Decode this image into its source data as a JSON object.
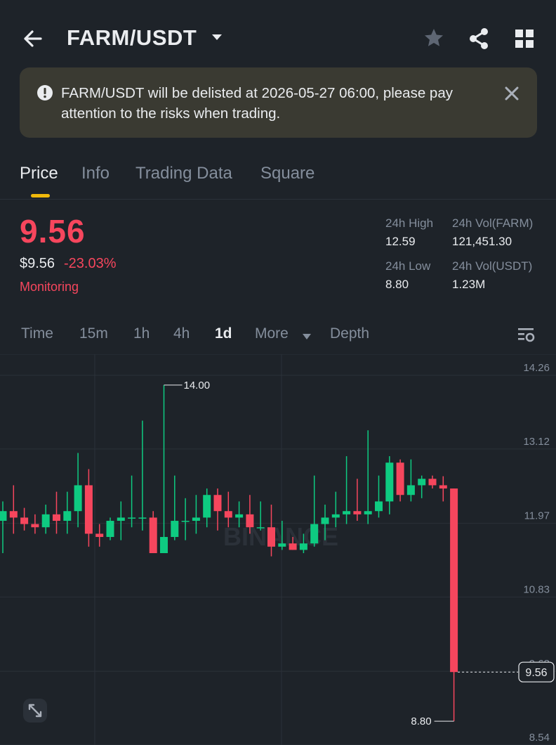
{
  "header": {
    "pair": "FARM/USDT",
    "icons": [
      "back-arrow-icon",
      "chevron-down-icon",
      "star-icon",
      "share-icon",
      "grid-icon"
    ]
  },
  "banner": {
    "text": "FARM/USDT will be delisted at 2026-05-27 06:00, please pay attention to the risks when trading.",
    "icon": "exclamation-circle-icon",
    "close_icon": "close-icon"
  },
  "tabs": [
    {
      "label": "Price",
      "active": true
    },
    {
      "label": "Info",
      "active": false
    },
    {
      "label": "Trading Data",
      "active": false
    },
    {
      "label": "Square",
      "active": false
    }
  ],
  "ticker": {
    "last_price": "9.56",
    "usd_price": "$9.56",
    "change": "-23.03%",
    "status": "Monitoring",
    "high_label": "24h High",
    "high_value": "12.59",
    "low_label": "24h Low",
    "low_value": "8.80",
    "vol_base_label": "24h Vol(FARM)",
    "vol_base_value": "121,451.30",
    "vol_quote_label": "24h Vol(USDT)",
    "vol_quote_value": "1.23M"
  },
  "timeframes": [
    {
      "label": "Time",
      "active": false
    },
    {
      "label": "15m",
      "active": false
    },
    {
      "label": "1h",
      "active": false
    },
    {
      "label": "4h",
      "active": false
    },
    {
      "label": "1d",
      "active": true
    },
    {
      "label": "More",
      "active": false
    },
    {
      "label": "Depth",
      "active": false
    }
  ],
  "colors": {
    "up": "#0ecb81",
    "down": "#f6465d",
    "accent": "#f0b90b",
    "bg": "#1e2329"
  },
  "chart_data": {
    "type": "candlestick",
    "y_ticks": [
      "14.26",
      "13.12",
      "11.97",
      "10.83",
      "9.68",
      "8.54"
    ],
    "ylim": [
      8.54,
      14.26
    ],
    "max_label": "14.00",
    "min_label": "8.80",
    "last_price_label": "9.56",
    "watermark": "BINANCE",
    "candles": [
      {
        "o": 11.9,
        "h": 12.2,
        "l": 11.4,
        "c": 12.05
      },
      {
        "o": 12.05,
        "h": 12.45,
        "l": 11.7,
        "c": 11.95
      },
      {
        "o": 11.95,
        "h": 12.1,
        "l": 11.75,
        "c": 11.85
      },
      {
        "o": 11.85,
        "h": 12.0,
        "l": 11.7,
        "c": 11.8
      },
      {
        "o": 11.8,
        "h": 12.15,
        "l": 11.7,
        "c": 12.0
      },
      {
        "o": 12.0,
        "h": 12.35,
        "l": 11.7,
        "c": 11.9
      },
      {
        "o": 11.9,
        "h": 12.35,
        "l": 11.7,
        "c": 12.05
      },
      {
        "o": 12.05,
        "h": 12.95,
        "l": 11.8,
        "c": 12.45
      },
      {
        "o": 12.45,
        "h": 12.7,
        "l": 11.5,
        "c": 11.7
      },
      {
        "o": 11.7,
        "h": 11.85,
        "l": 11.5,
        "c": 11.65
      },
      {
        "o": 11.65,
        "h": 11.95,
        "l": 11.6,
        "c": 11.9
      },
      {
        "o": 11.9,
        "h": 12.2,
        "l": 11.6,
        "c": 11.95
      },
      {
        "o": 11.95,
        "h": 12.6,
        "l": 11.8,
        "c": 11.95
      },
      {
        "o": 11.95,
        "h": 13.45,
        "l": 11.75,
        "c": 11.95
      },
      {
        "o": 11.95,
        "h": 12.05,
        "l": 11.4,
        "c": 11.4
      },
      {
        "o": 11.4,
        "h": 14.0,
        "l": 11.4,
        "c": 11.65
      },
      {
        "o": 11.65,
        "h": 12.6,
        "l": 11.6,
        "c": 11.9
      },
      {
        "o": 11.9,
        "h": 12.25,
        "l": 11.6,
        "c": 11.9
      },
      {
        "o": 11.9,
        "h": 12.3,
        "l": 11.7,
        "c": 11.95
      },
      {
        "o": 11.95,
        "h": 12.4,
        "l": 11.8,
        "c": 12.3
      },
      {
        "o": 12.3,
        "h": 12.4,
        "l": 11.75,
        "c": 12.05
      },
      {
        "o": 12.05,
        "h": 12.35,
        "l": 11.8,
        "c": 11.95
      },
      {
        "o": 11.95,
        "h": 12.2,
        "l": 11.8,
        "c": 12.0
      },
      {
        "o": 12.0,
        "h": 12.3,
        "l": 11.7,
        "c": 11.8
      },
      {
        "o": 11.8,
        "h": 12.2,
        "l": 11.75,
        "c": 11.8
      },
      {
        "o": 11.8,
        "h": 12.15,
        "l": 11.35,
        "c": 11.5
      },
      {
        "o": 11.5,
        "h": 11.9,
        "l": 11.45,
        "c": 11.55
      },
      {
        "o": 11.55,
        "h": 11.65,
        "l": 11.45,
        "c": 11.45
      },
      {
        "o": 11.45,
        "h": 11.7,
        "l": 11.4,
        "c": 11.55
      },
      {
        "o": 11.55,
        "h": 12.6,
        "l": 11.5,
        "c": 11.85
      },
      {
        "o": 11.85,
        "h": 12.15,
        "l": 11.6,
        "c": 11.95
      },
      {
        "o": 11.95,
        "h": 12.35,
        "l": 11.8,
        "c": 12.0
      },
      {
        "o": 12.0,
        "h": 12.9,
        "l": 11.85,
        "c": 12.05
      },
      {
        "o": 12.05,
        "h": 12.55,
        "l": 11.9,
        "c": 12.0
      },
      {
        "o": 12.0,
        "h": 13.3,
        "l": 11.85,
        "c": 12.05
      },
      {
        "o": 12.05,
        "h": 12.6,
        "l": 11.95,
        "c": 12.2
      },
      {
        "o": 12.2,
        "h": 12.9,
        "l": 12.0,
        "c": 12.8
      },
      {
        "o": 12.8,
        "h": 12.85,
        "l": 12.2,
        "c": 12.3
      },
      {
        "o": 12.3,
        "h": 12.85,
        "l": 12.2,
        "c": 12.45
      },
      {
        "o": 12.45,
        "h": 12.6,
        "l": 12.25,
        "c": 12.55
      },
      {
        "o": 12.55,
        "h": 12.6,
        "l": 12.4,
        "c": 12.45
      },
      {
        "o": 12.45,
        "h": 12.59,
        "l": 12.2,
        "c": 12.4
      },
      {
        "o": 12.4,
        "h": 12.4,
        "l": 8.8,
        "c": 9.56
      }
    ]
  }
}
